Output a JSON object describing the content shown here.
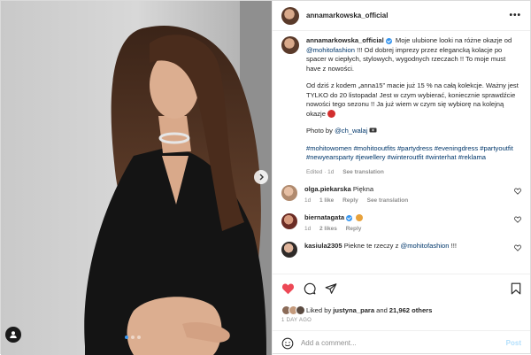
{
  "post": {
    "author": "annamarkowska_official",
    "header_more": "•••",
    "caption": {
      "username": "annamarkowska_official",
      "line1_prefix": " Moje ulubione looki na różne okazje od ",
      "line1_mention": "@mohitofashion",
      "line1_suffix": " !!! Od dobrej imprezy przez elegancką kolacje po spacer w ciepłych, stylowych, wygodnych rzeczach !! To moje must have z nowości.",
      "para2": "Od dziś z kodem „anna15” macie już 15 % na całą kolekcje. Ważny jest TYLKO do 20 listopada! Jest w czym wybierać, koniecznie sprawdźcie nowości tego sezonu !! Ja już wiem w czym się wybiorę na kolejną okazje",
      "photo_by": "Photo by ",
      "photo_mention": "@ch_walaj",
      "hashtags": "#mohitowomen #mohitooutfits #partydress #eveningdress #partyoutfit #newyearsparty #jewellery #winteroutfit #winterhat #reklama",
      "edited": "Edited · 1d",
      "see_translation": "See translation"
    },
    "comments": [
      {
        "username": "olga.piekarska",
        "text": "Piękna",
        "age": "1d",
        "likes": "1 like",
        "reply": "Reply",
        "see_translation": "See translation"
      },
      {
        "username": "biernatagata",
        "text": "",
        "age": "1d",
        "likes": "2 likes",
        "reply": "Reply"
      },
      {
        "username": "kasiula2305",
        "text": "Piekne te rzeczy z ",
        "mention": "@mohitofashion",
        "suffix": " !!!"
      }
    ],
    "likes": {
      "prefix": "Liked by ",
      "user": "justyna_para",
      "middle": " and ",
      "count": "21,962 others"
    },
    "timestamp": "1 DAY AGO",
    "add_comment": {
      "placeholder": "Add a comment...",
      "post_label": "Post"
    }
  },
  "icons": {
    "like": "heart-filled-icon",
    "comment": "comment-icon",
    "share": "share-icon",
    "save": "bookmark-icon",
    "emoji": "emoji-icon",
    "next": "chevron-right-icon",
    "tags": "user-tag-icon"
  },
  "colors": {
    "like_red": "#ed4956",
    "link_blue": "#00376b",
    "verified_blue": "#3897f0",
    "post_disabled": "#b2dffc"
  },
  "carousel": {
    "total": 3,
    "active": 1
  }
}
